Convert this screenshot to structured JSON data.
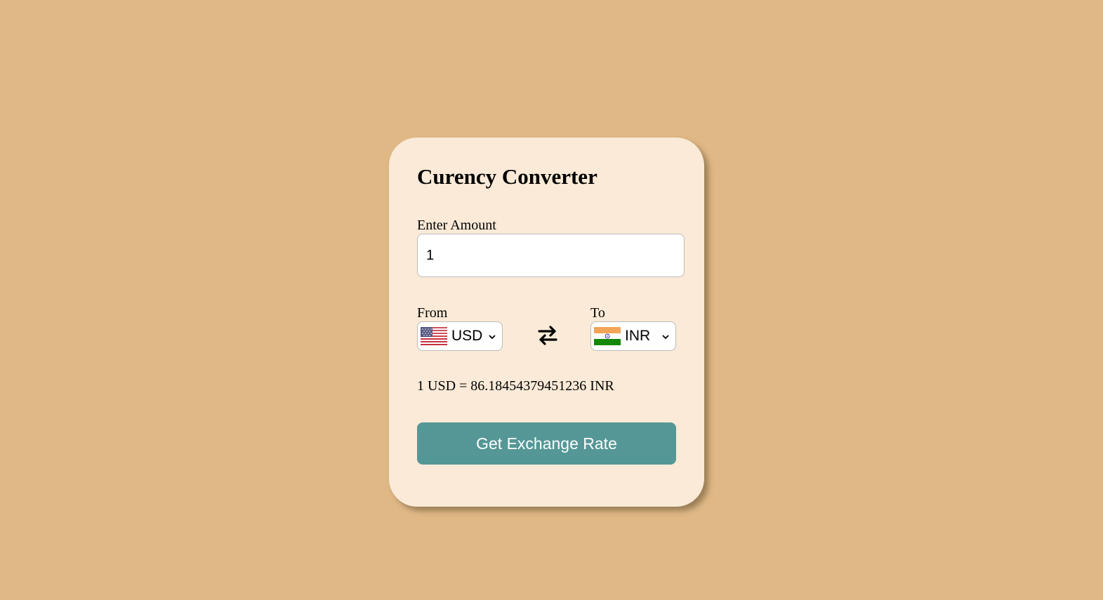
{
  "app": {
    "title": "Curency Converter"
  },
  "amount": {
    "label": "Enter Amount",
    "value": "1"
  },
  "from": {
    "label": "From",
    "currency": "USD",
    "flag_icon": "us-flag-icon"
  },
  "to": {
    "label": "To",
    "currency": "INR",
    "flag_icon": "india-flag-icon"
  },
  "swap_icon": "swap-arrows-icon",
  "result": {
    "text": "1 USD = 86.18454379451236 INR"
  },
  "button": {
    "label": "Get Exchange Rate"
  },
  "colors": {
    "background": "#DFB886",
    "card": "#FAEAD7",
    "button": "#559796"
  }
}
